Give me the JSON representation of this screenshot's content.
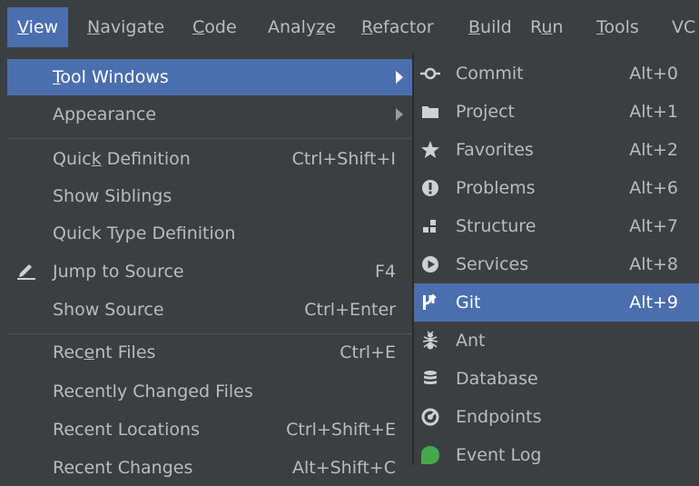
{
  "menubar": {
    "items": [
      {
        "label": "View",
        "mnemonic": "V",
        "rest": "iew"
      },
      {
        "label": "Navigate",
        "mnemonic": "N",
        "rest": "avigate"
      },
      {
        "label": "Code",
        "mnemonic": "C",
        "rest": "ode"
      },
      {
        "label": "Analyze",
        "pre": "Analy",
        "mnemonic": "z",
        "rest": "e"
      },
      {
        "label": "Refactor",
        "mnemonic": "R",
        "rest": "efactor"
      },
      {
        "label": "Build",
        "mnemonic": "B",
        "rest": "uild"
      },
      {
        "label": "Run",
        "pre": "R",
        "mnemonic": "u",
        "rest": "n"
      },
      {
        "label": "Tools",
        "mnemonic": "T",
        "rest": "ools"
      },
      {
        "label": "VC"
      }
    ]
  },
  "view_menu": {
    "items": [
      {
        "label": "Tool Windows",
        "pre": "",
        "mnemonic": "T",
        "rest": "ool Windows",
        "shortcut": "",
        "submenu": true,
        "selected": true
      },
      {
        "label": "Appearance",
        "shortcut": "",
        "submenu": true
      },
      {
        "label": "Quick Definition",
        "pre": "Quic",
        "mnemonic": "k",
        "rest": " Definition",
        "shortcut": "Ctrl+Shift+I"
      },
      {
        "label": "Show Siblings",
        "shortcut": ""
      },
      {
        "label": "Quick Type Definition",
        "shortcut": ""
      },
      {
        "label": "Jump to Source",
        "shortcut": "F4",
        "icon": "pencil-icon"
      },
      {
        "label": "Show Source",
        "shortcut": "Ctrl+Enter"
      },
      {
        "label": "Recent Files",
        "pre": "Rec",
        "mnemonic": "e",
        "rest": "nt Files",
        "shortcut": "Ctrl+E"
      },
      {
        "label": "Recently Changed Files",
        "shortcut": ""
      },
      {
        "label": "Recent Locations",
        "shortcut": "Ctrl+Shift+E"
      },
      {
        "label": "Recent Changes",
        "shortcut": "Alt+Shift+C"
      }
    ]
  },
  "tool_windows_menu": {
    "items": [
      {
        "label": "Commit",
        "shortcut": "Alt+0",
        "icon": "commit-icon"
      },
      {
        "label": "Project",
        "shortcut": "Alt+1",
        "icon": "folder-icon"
      },
      {
        "label": "Favorites",
        "shortcut": "Alt+2",
        "icon": "star-icon"
      },
      {
        "label": "Problems",
        "shortcut": "Alt+6",
        "icon": "problems-icon"
      },
      {
        "label": "Structure",
        "shortcut": "Alt+7",
        "icon": "structure-icon"
      },
      {
        "label": "Services",
        "shortcut": "Alt+8",
        "icon": "services-icon"
      },
      {
        "label": "Git",
        "shortcut": "Alt+9",
        "icon": "git-icon",
        "selected": true
      },
      {
        "label": "Ant",
        "shortcut": "",
        "icon": "ant-icon"
      },
      {
        "label": "Database",
        "shortcut": "",
        "icon": "database-icon"
      },
      {
        "label": "Endpoints",
        "shortcut": "",
        "icon": "endpoints-icon"
      },
      {
        "label": "Event Log",
        "shortcut": "",
        "icon": "event-log-icon"
      }
    ]
  },
  "colors": {
    "background": "#3c3f41",
    "selection": "#4b6eaf",
    "text": "#bbbbbb",
    "selected_text": "#ffffff",
    "event_log_green": "#45a94c"
  }
}
